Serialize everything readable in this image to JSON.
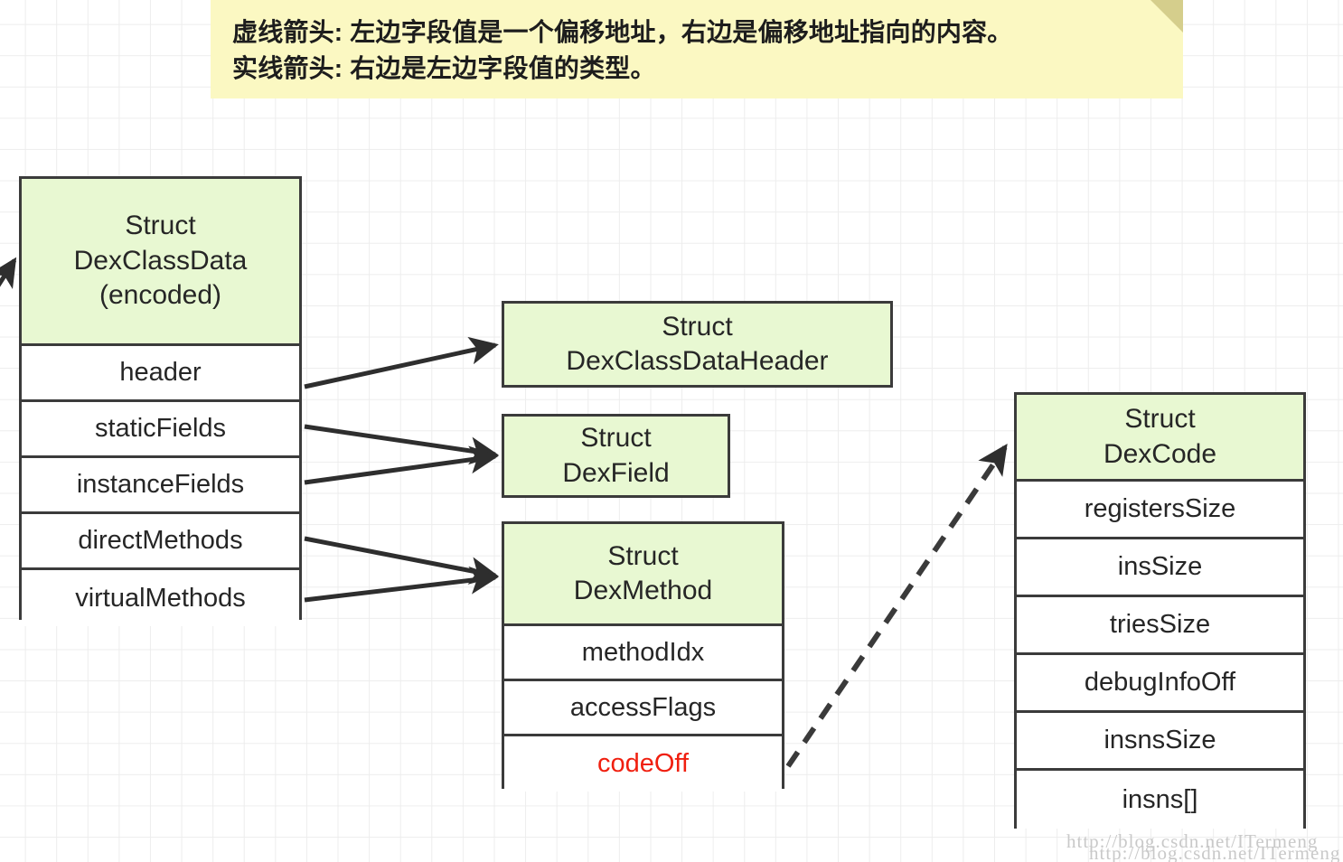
{
  "legend": {
    "line1": "虚线箭头: 左边字段值是一个偏移地址，右边是偏移地址指向的内容。",
    "line2": "实线箭头: 右边是左边字段值的类型。",
    "bg_color": "#fbf8c2",
    "fold_color": "#d5ce8c"
  },
  "colors": {
    "struct_header_fill": "#e8f8d2",
    "row_fill": "#ffffff",
    "border": "#3b3b3b",
    "accent_text": "#f01f0f",
    "grid_line": "#ededed",
    "text": "#262626"
  },
  "boxes": {
    "classdata": {
      "title_line1": "Struct",
      "title_line2": "DexClassData",
      "title_line3": "(encoded)",
      "rows": [
        "header",
        "staticFields",
        "instanceFields",
        "directMethods",
        "virtualMethods"
      ]
    },
    "classdataheader": {
      "title_line1": "Struct",
      "title_line2": "DexClassDataHeader"
    },
    "dexfield": {
      "title_line1": "Struct",
      "title_line2": "DexField"
    },
    "dexmethod": {
      "title_line1": "Struct",
      "title_line2": "DexMethod",
      "rows": [
        "methodIdx",
        "accessFlags",
        "codeOff"
      ],
      "accent_row": "codeOff"
    },
    "dexcode": {
      "title_line1": "Struct",
      "title_line2": "DexCode",
      "rows": [
        "registersSize",
        "insSize",
        "triesSize",
        "debugInfoOff",
        "insnsSize",
        "insns[]"
      ]
    }
  },
  "connections": [
    {
      "from": "header",
      "to": "classdataheader",
      "style": "solid"
    },
    {
      "from": "staticFields",
      "to": "dexfield",
      "style": "solid"
    },
    {
      "from": "instanceFields",
      "to": "dexfield",
      "style": "solid"
    },
    {
      "from": "directMethods",
      "to": "dexmethod",
      "style": "solid"
    },
    {
      "from": "virtualMethods",
      "to": "dexmethod",
      "style": "solid"
    },
    {
      "from": "codeOff",
      "to": "dexcode",
      "style": "dashed"
    },
    {
      "from": "offscreen",
      "to": "classdata",
      "style": "solid"
    }
  ],
  "watermark": {
    "line1": "http://blog.csdn.net/ITermeng",
    "line2": "http://blog.csdn.net/ITermeng"
  }
}
